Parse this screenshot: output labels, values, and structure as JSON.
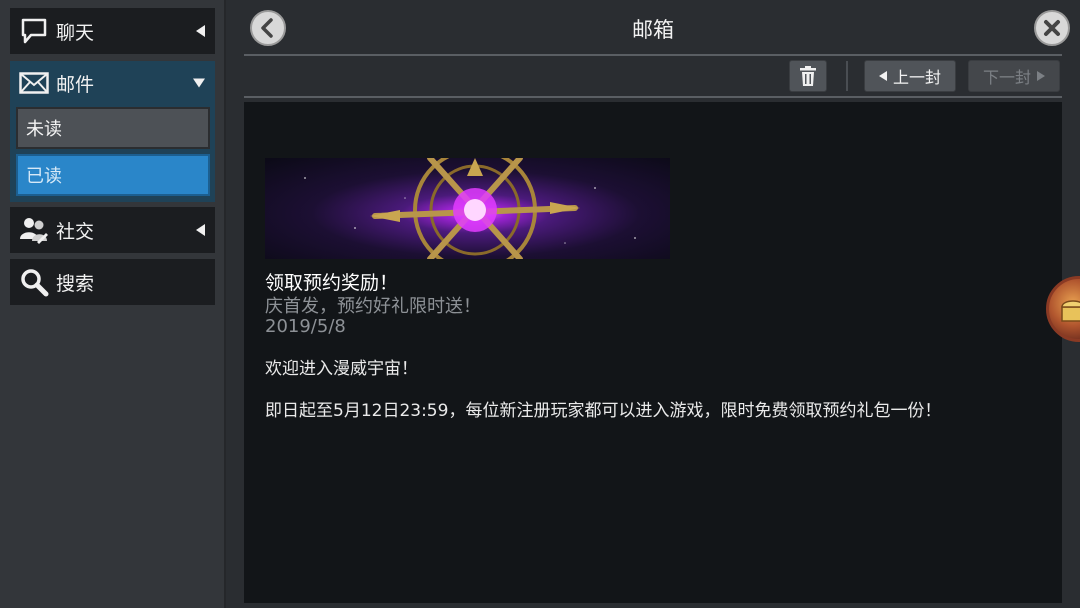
{
  "sidebar": {
    "chat": {
      "label": "聊天",
      "icon": "speech-bubble-icon"
    },
    "mail": {
      "label": "邮件",
      "icon": "envelope-icon",
      "sub": {
        "unread": "未读",
        "read": "已读"
      }
    },
    "social": {
      "label": "社交",
      "icon": "people-icon"
    },
    "search": {
      "label": "搜索",
      "icon": "magnifier-icon"
    }
  },
  "header": {
    "title": "邮箱"
  },
  "toolbar": {
    "prev_label": "上一封",
    "next_label": "下一封"
  },
  "mail": {
    "title": "领取预约奖励！",
    "subtitle": "庆首发，预约好礼限时送！",
    "date": "2019/5/8",
    "body_1": "欢迎进入漫威宇宙！",
    "body_2": "即日起至5月12日23:59，每位新注册玩家都可以进入游戏，限时免费领取预约礼包一份！"
  },
  "colors": {
    "accent": "#2a86c9",
    "mail_group_bg": "#1f4257",
    "panel_bg": "#121518"
  }
}
